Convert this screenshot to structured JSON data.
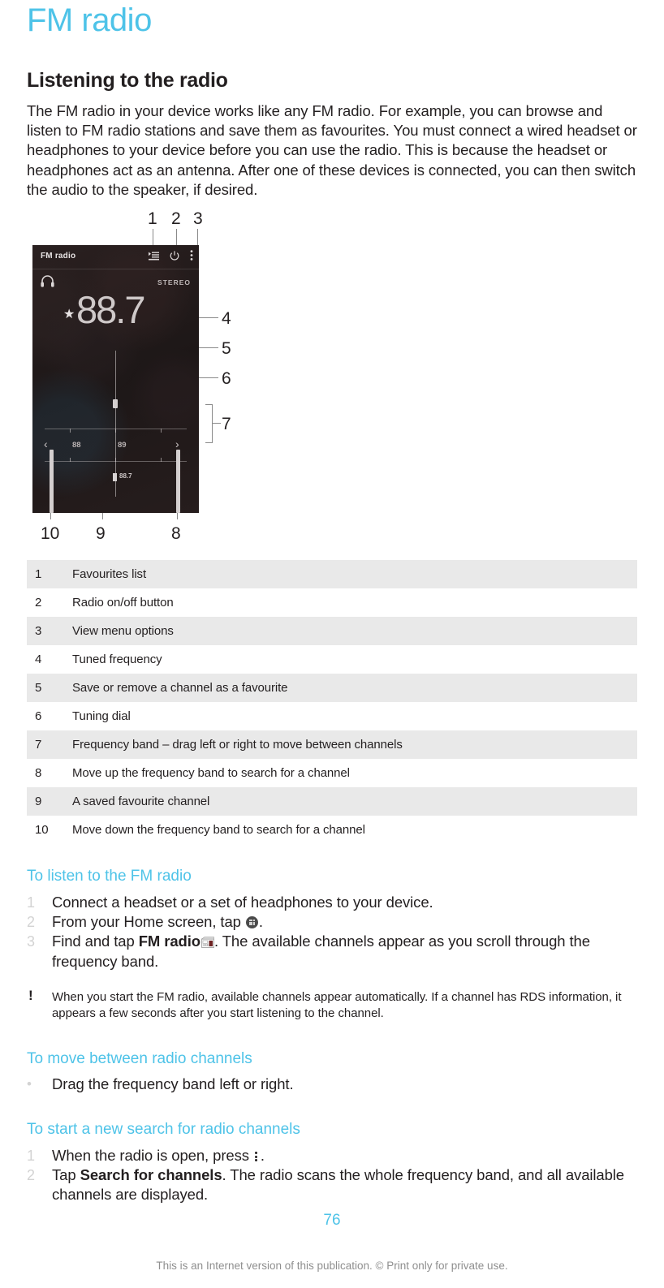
{
  "page": {
    "title": "FM radio",
    "number": "76",
    "footer_note": "This is an Internet version of this publication. © Print only for private use.",
    "accent_color": "#4ec3e8",
    "text_color": "#231f20",
    "row_shade_color": "#e9e9e9"
  },
  "intro": {
    "heading": "Listening to the radio",
    "paragraph": "The FM radio in your device works like any FM radio. For example, you can browse and listen to FM radio stations and save them as favourites. You must connect a wired headset or headphones to your device before you can use the radio. This is because the headset or headphones act as an antenna. After one of these devices is connected, you can then switch the audio to the speaker, if desired."
  },
  "illustration": {
    "callouts": [
      "1",
      "2",
      "3",
      "4",
      "5",
      "6",
      "7",
      "8",
      "9",
      "10"
    ],
    "phone": {
      "app_title": "FM radio",
      "stereo_label": "STEREO",
      "tuned_frequency": "88.7",
      "band_labels": [
        "88",
        "89"
      ],
      "favourite_marker_label": "88.7",
      "icons": [
        "favourites-list-icon",
        "power-icon",
        "overflow-menu-icon",
        "headphones-icon",
        "star-favourite-icon",
        "chevron-left-icon",
        "chevron-right-icon"
      ]
    }
  },
  "legend": {
    "rows": [
      {
        "num": "1",
        "desc": "Favourites list"
      },
      {
        "num": "2",
        "desc": "Radio on/off button"
      },
      {
        "num": "3",
        "desc": "View menu options"
      },
      {
        "num": "4",
        "desc": "Tuned frequency"
      },
      {
        "num": "5",
        "desc": "Save or remove a channel as a favourite"
      },
      {
        "num": "6",
        "desc": "Tuning dial"
      },
      {
        "num": "7",
        "desc": "Frequency band – drag left or right to move between channels"
      },
      {
        "num": "8",
        "desc": "Move up the frequency band to search for a channel"
      },
      {
        "num": "9",
        "desc": "A saved favourite channel"
      },
      {
        "num": "10",
        "desc": "Move down the frequency band to search for a channel"
      }
    ]
  },
  "sections": [
    {
      "heading": "To listen to the FM radio",
      "steps": [
        {
          "marker": "1",
          "text_before": "Connect a headset or a set of headphones to your device.",
          "icon": null,
          "text_after": ""
        },
        {
          "marker": "2",
          "text_before": "From your Home screen, tap ",
          "icon": "app-drawer-icon",
          "text_after": "."
        },
        {
          "marker": "3",
          "text_before": "Find and tap ",
          "bold": "FM radio",
          "icon": "fm-radio-app-icon",
          "text_after": ". The available channels appear as you scroll through the frequency band."
        }
      ],
      "note": "When you start the FM radio, available channels appear automatically. If a channel has RDS information, it appears a few seconds after you start listening to the channel."
    },
    {
      "heading": "To move between radio channels",
      "steps": [
        {
          "marker": "•",
          "text_before": "Drag the frequency band left or right.",
          "icon": null,
          "text_after": ""
        }
      ]
    },
    {
      "heading": "To start a new search for radio channels",
      "steps": [
        {
          "marker": "1",
          "text_before": "When the radio is open, press ",
          "icon": "overflow-menu-icon",
          "text_after": "."
        },
        {
          "marker": "2",
          "text_before": "Tap ",
          "bold": "Search for channels",
          "icon": null,
          "text_after": ". The radio scans the whole frequency band, and all available channels are displayed."
        }
      ]
    }
  ]
}
